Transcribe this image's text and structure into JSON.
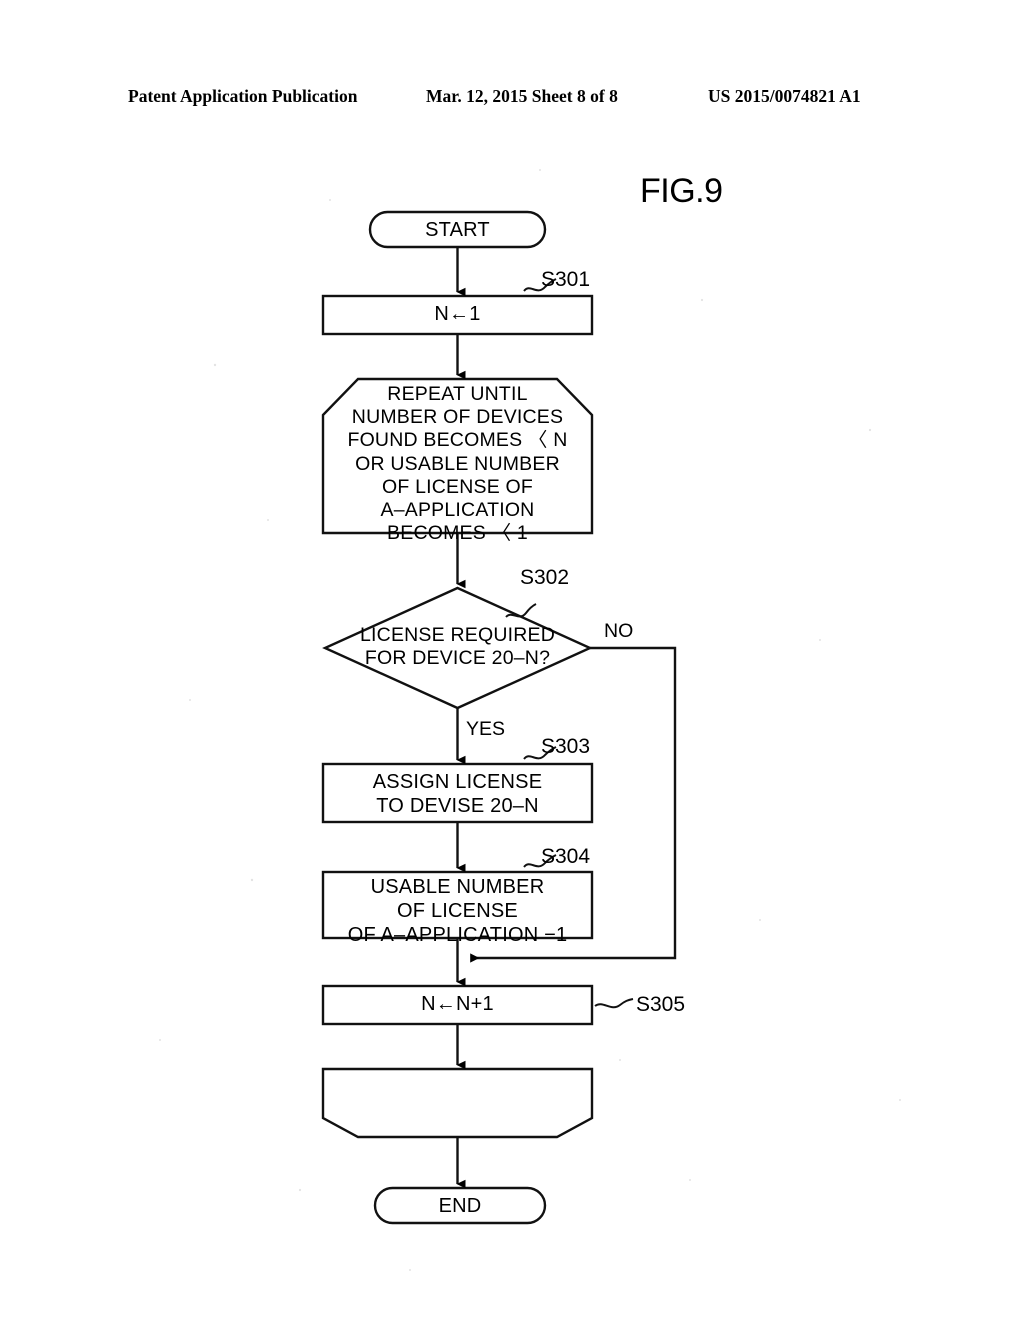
{
  "header": {
    "left": "Patent Application Publication",
    "middle": "Mar. 12, 2015  Sheet 8 of 8",
    "right": "US 2015/0074821 A1"
  },
  "figure": {
    "title": "FIG.9",
    "type": "flowchart",
    "ink_color": "#000000",
    "paper_color": "#ffffff"
  },
  "nodes": {
    "start": {
      "label": "START",
      "shape": "stadium"
    },
    "s301": {
      "label": "N←1",
      "shape": "rectangle",
      "step": "S301"
    },
    "loop_begin": {
      "label": "REPEAT UNTIL\nNUMBER OF DEVICES\nFOUND BECOMES 〈 N\nOR USABLE NUMBER\nOF LICENSE OF\nA–APPLICATION\nBECOMES 〈 1",
      "shape": "loop-limit-top",
      "step": ""
    },
    "s302": {
      "label": "LICENSE REQUIRED\nFOR DEVICE 20–N?",
      "shape": "diamond",
      "step": "S302",
      "yes_label": "YES",
      "no_label": "NO"
    },
    "s303": {
      "label": "ASSIGN LICENSE\nTO DEVISE 20–N",
      "shape": "rectangle",
      "step": "S303"
    },
    "s304": {
      "label": "USABLE NUMBER\nOF LICENSE\nOF A–APPLICATION −1",
      "shape": "rectangle",
      "step": "S304"
    },
    "s305": {
      "label": "N←N+1",
      "shape": "rectangle",
      "step": "S305"
    },
    "loop_end": {
      "label": "",
      "shape": "loop-limit-bottom",
      "step": ""
    },
    "end": {
      "label": "END",
      "shape": "stadium"
    }
  },
  "edges": [
    {
      "from": "start",
      "to": "s301",
      "label": ""
    },
    {
      "from": "s301",
      "to": "loop_begin",
      "label": ""
    },
    {
      "from": "loop_begin",
      "to": "s302",
      "label": ""
    },
    {
      "from": "s302",
      "to": "s303",
      "label": "YES"
    },
    {
      "from": "s302",
      "to": "s305",
      "label": "NO"
    },
    {
      "from": "s303",
      "to": "s304",
      "label": ""
    },
    {
      "from": "s304",
      "to": "s305",
      "label": ""
    },
    {
      "from": "s305",
      "to": "loop_end",
      "label": ""
    },
    {
      "from": "loop_end",
      "to": "end",
      "label": ""
    }
  ]
}
